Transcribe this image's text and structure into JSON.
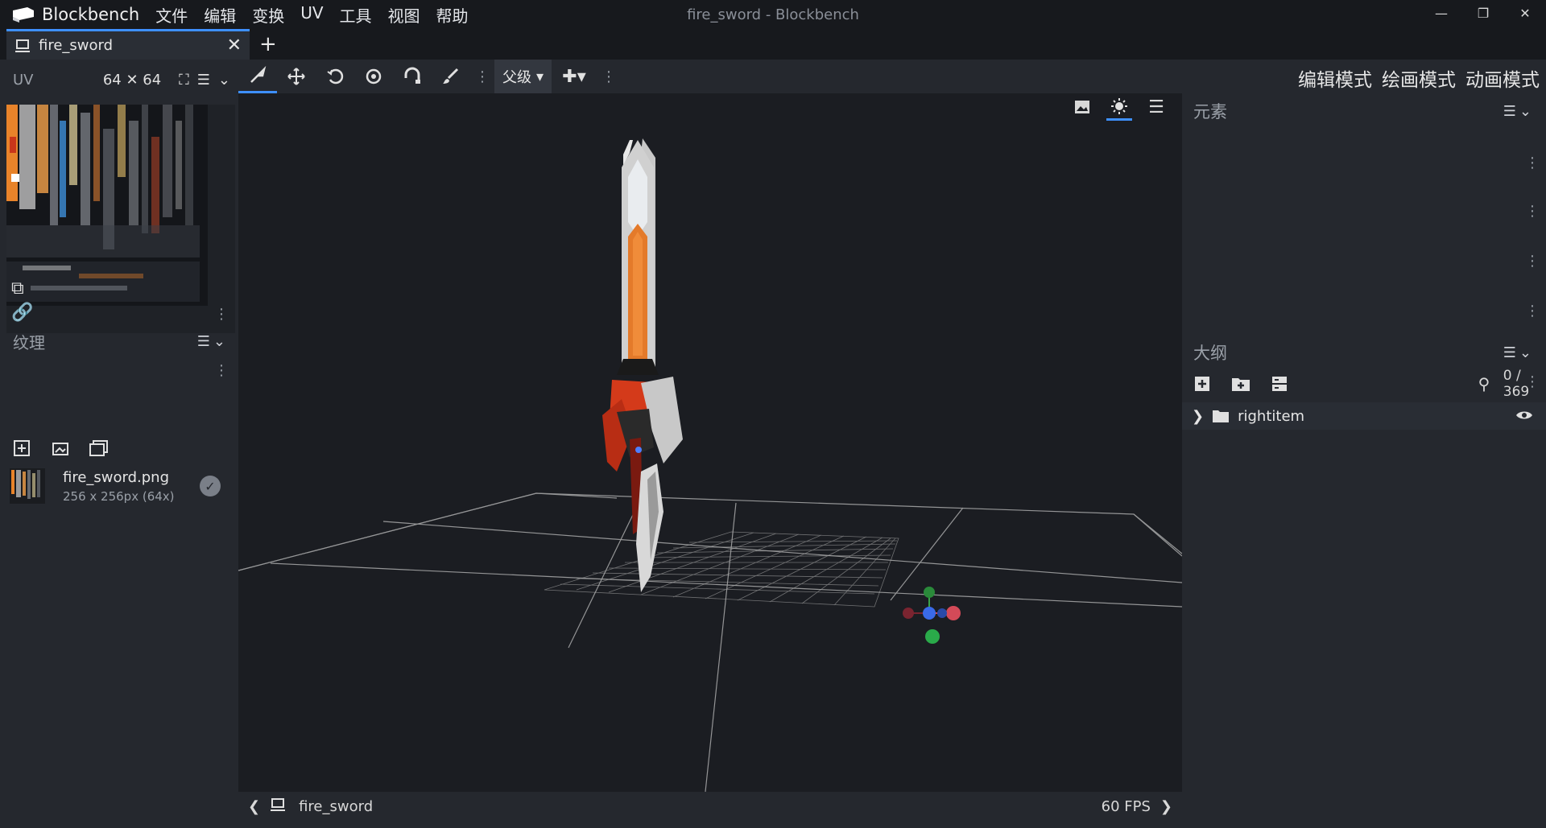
{
  "app": {
    "name": "Blockbench",
    "window_title": "fire_sword - Blockbench"
  },
  "menu": [
    "文件",
    "编辑",
    "变换",
    "UV",
    "工具",
    "视图",
    "帮助"
  ],
  "tabs": [
    {
      "label": "fire_sword"
    }
  ],
  "uv_panel": {
    "title": "UV",
    "size": "64 ✕ 64"
  },
  "textures_panel": {
    "title": "纹理",
    "items": [
      {
        "name": "fire_sword.png",
        "info": "256 x 256px (64x)"
      }
    ]
  },
  "toolbar": {
    "parent_select": "父级"
  },
  "modes": [
    {
      "label": "编辑模式",
      "active": true
    },
    {
      "label": "绘画模式",
      "active": false
    },
    {
      "label": "动画模式",
      "active": false
    }
  ],
  "elements_panel": {
    "title": "元素"
  },
  "outliner": {
    "title": "大纲",
    "count": "0 / 369",
    "items": [
      {
        "label": "rightitem"
      }
    ]
  },
  "status": {
    "model_name": "fire_sword",
    "fps": "60 FPS"
  },
  "colors": {
    "accent": "#3e90ff",
    "background": "#1b1d22",
    "panel": "#25282e"
  }
}
